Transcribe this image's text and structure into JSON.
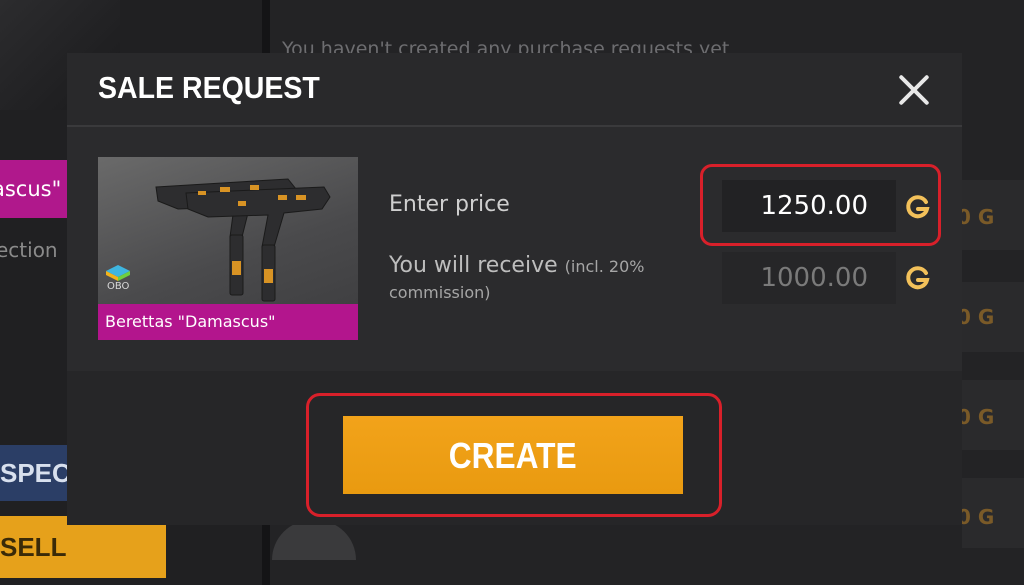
{
  "background": {
    "item_tag_text": "ascus\"",
    "collection_text": "ection",
    "inspect_label": "SPECT",
    "sell_label": "SELL",
    "empty_message": "You haven't created any purchase requests yet",
    "currency_symbol": "0 G"
  },
  "modal": {
    "title": "SALE REQUEST",
    "close_icon": "close-icon",
    "item": {
      "name": "Berettas \"Damascus\"",
      "rarity_code": "OBO",
      "rarity_color": "#b3158d"
    },
    "price_label": "Enter price",
    "price_value": "1250.00",
    "receive_label": "You will receive",
    "receive_note": "(incl. 20%",
    "receive_note_2": "commission)",
    "receive_value": "1000.00",
    "currency_icon": "gold-currency-icon",
    "create_label": "CREATE"
  },
  "colors": {
    "accent": "#f2a31a",
    "highlight": "#d8202a",
    "gold": "#f3c15a"
  }
}
